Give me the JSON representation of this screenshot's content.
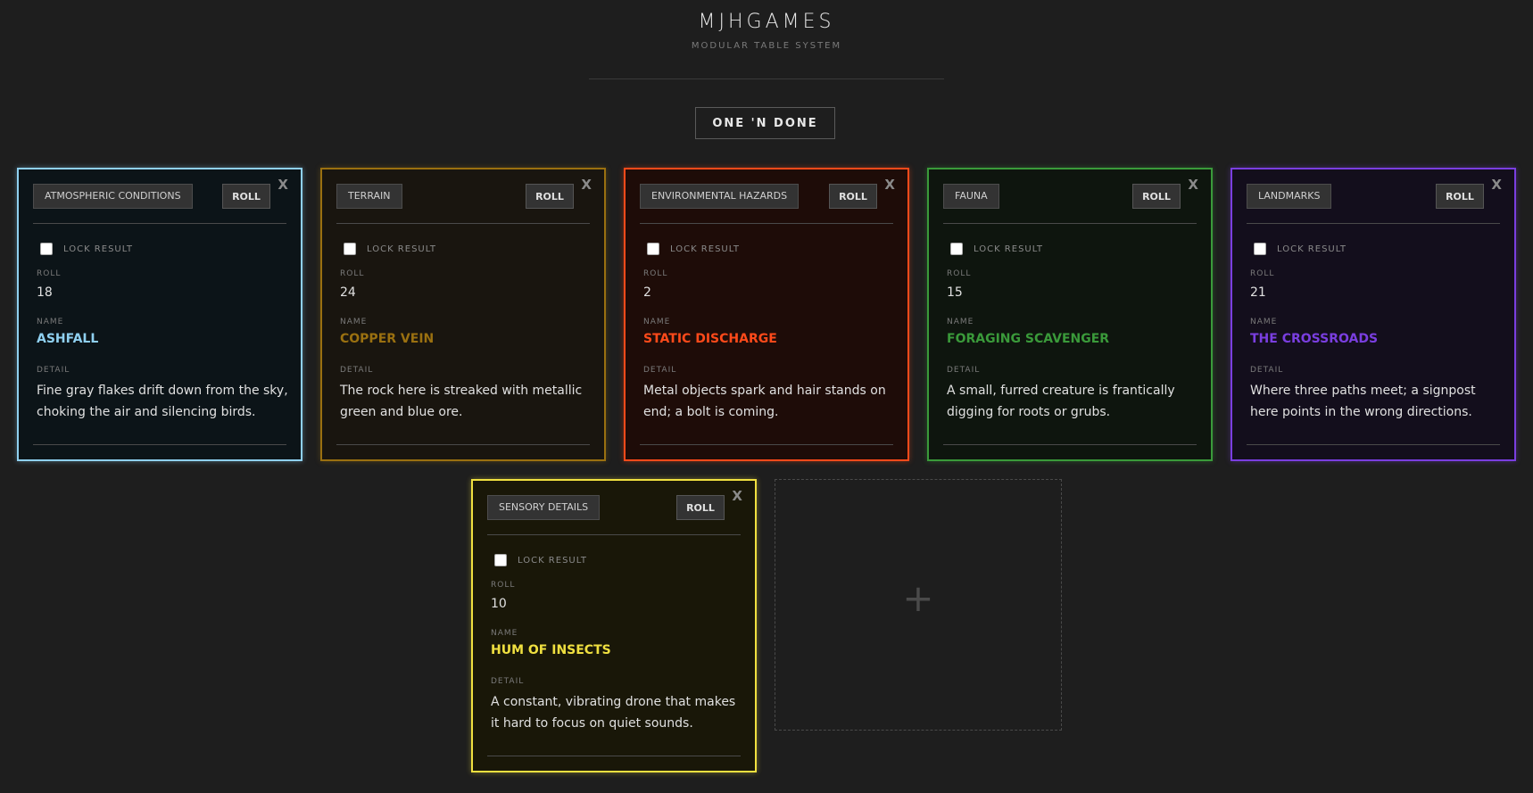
{
  "header": {
    "brand": "MJHGAMES",
    "subtitle": "MODULAR TABLE SYSTEM",
    "mode_button": "ONE 'N DONE"
  },
  "labels": {
    "roll_button": "ROLL",
    "close": "X",
    "lock_result": "LOCK RESULT",
    "roll": "ROLL",
    "name": "NAME",
    "detail": "DETAIL"
  },
  "cards": [
    {
      "table": "ATMOSPHERIC CONDITIONS",
      "roll": "18",
      "name": "ASHFALL",
      "detail": "Fine gray flakes drift down from the sky, choking the air and silencing birds.",
      "accent": "#8fd0f0",
      "background": "#0c1418",
      "locked": false
    },
    {
      "table": "TERRAIN",
      "roll": "24",
      "name": "COPPER VEIN",
      "detail": "The rock here is streaked with metallic green and blue ore.",
      "accent": "#9a7010",
      "background": "#19150f",
      "locked": false
    },
    {
      "table": "ENVIRONMENTAL HAZARDS",
      "roll": "2",
      "name": "STATIC DISCHARGE",
      "detail": "Metal objects spark and hair stands on end; a bolt is coming.",
      "accent": "#ff4a1a",
      "background": "#1e0c08",
      "locked": false
    },
    {
      "table": "FAUNA",
      "roll": "15",
      "name": "FORAGING SCAVENGER",
      "detail": "A small, furred creature is frantically digging for roots or grubs.",
      "accent": "#3a9a3a",
      "background": "#0e150e",
      "locked": false
    },
    {
      "table": "LANDMARKS",
      "roll": "21",
      "name": "THE CROSSROADS",
      "detail": "Where three paths meet; a signpost here points in the wrong directions.",
      "accent": "#7a3ee0",
      "background": "#130e1c",
      "locked": false
    },
    {
      "table": "SENSORY DETAILS",
      "roll": "10",
      "name": "HUM OF INSECTS",
      "detail": "A constant, vibrating drone that makes it hard to focus on quiet sounds.",
      "accent": "#f0e040",
      "background": "#191708",
      "locked": false
    }
  ],
  "add_slot": {
    "icon": "plus-icon",
    "glyph": "+"
  }
}
